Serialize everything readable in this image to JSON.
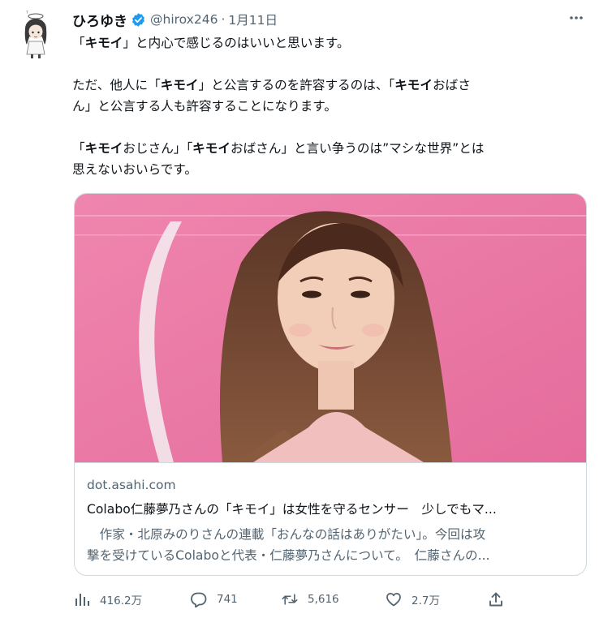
{
  "author": {
    "name": "ひろゆき",
    "handle": "@hirox246",
    "separator": "·",
    "date": "1月11日"
  },
  "tweet": {
    "lines": [
      [
        "「",
        {
          "b": "キモイ"
        },
        "」と内心で感じるのはいいと思います。"
      ],
      [],
      [
        "ただ、他人に「",
        {
          "b": "キモイ"
        },
        "」と公言するのを許容するのは、「",
        {
          "b": "キモイ"
        },
        "おばさ"
      ],
      [
        "ん」と公言する人も許容することになります。"
      ],
      [],
      [
        "「",
        {
          "b": "キモイ"
        },
        "おじさん」「",
        {
          "b": "キモイ"
        },
        "おばさん」と言い争うのは”マシな世界”とは"
      ],
      [
        "思えないおいらです。"
      ]
    ]
  },
  "card": {
    "domain": "dot.asahi.com",
    "title": "Colabo仁藤夢乃さんの「キモイ」は女性を守るセンサー　少しでもマ...",
    "description_line1": "　作家・北原みのりさんの連載「おんなの話はありがたい」。今回は攻",
    "description_line2": "撃を受けているColaboと代表・仁藤夢乃さんについて。　仁藤さんの..."
  },
  "actions": {
    "views": "416.2万",
    "replies": "741",
    "retweets": "5,616",
    "likes": "2.7万"
  },
  "icons": {
    "verified": "verified-badge-icon",
    "more": "more-dots-icon",
    "views": "views-chart-icon",
    "reply": "reply-bubble-icon",
    "retweet": "retweet-arrows-icon",
    "like": "heart-icon",
    "share": "share-upload-icon"
  },
  "colors": {
    "verified": "#1d9bf0",
    "text": "#0f1419",
    "muted": "#536471",
    "border": "#cfd9de",
    "photo_background": "#ea7ba5"
  }
}
